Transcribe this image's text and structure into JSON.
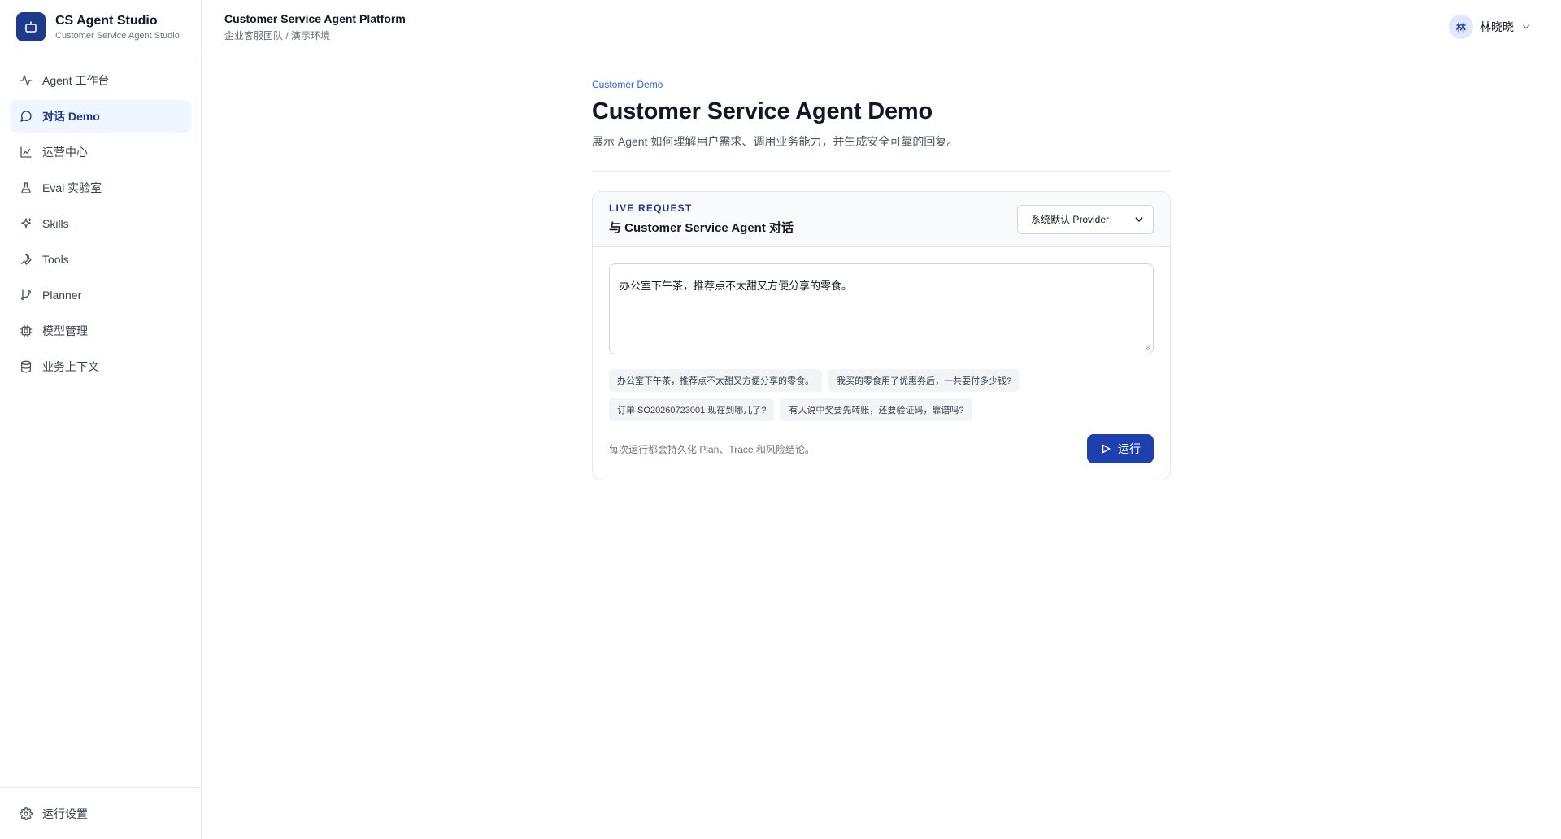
{
  "brand": {
    "title": "CS Agent Studio",
    "subtitle": "Customer Service Agent Studio"
  },
  "sidebar": {
    "items": [
      {
        "label": "Agent 工作台",
        "icon": "activity-icon",
        "active": false
      },
      {
        "label": "对话 Demo",
        "icon": "chat-icon",
        "active": true
      },
      {
        "label": "运营中心",
        "icon": "chart-icon",
        "active": false
      },
      {
        "label": "Eval 实验室",
        "icon": "flask-icon",
        "active": false
      },
      {
        "label": "Skills",
        "icon": "sparkles-icon",
        "active": false
      },
      {
        "label": "Tools",
        "icon": "wrench-icon",
        "active": false
      },
      {
        "label": "Planner",
        "icon": "branch-icon",
        "active": false
      },
      {
        "label": "模型管理",
        "icon": "cpu-icon",
        "active": false
      },
      {
        "label": "业务上下文",
        "icon": "database-icon",
        "active": false
      }
    ],
    "bottom": {
      "label": "运行设置",
      "icon": "gear-icon"
    }
  },
  "topbar": {
    "title": "Customer Service Agent Platform",
    "subtitle": "企业客服团队 / 演示环境",
    "user": {
      "avatar": "林",
      "name": "林晓晓"
    }
  },
  "page": {
    "eyebrow": "Customer Demo",
    "title": "Customer Service Agent Demo",
    "description": "展示 Agent 如何理解用户需求、调用业务能力，并生成安全可靠的回复。"
  },
  "card": {
    "kicker": "LIVE REQUEST",
    "title": "与 Customer Service Agent 对话",
    "provider": "系统默认 Provider",
    "input_value": "办公室下午茶，推荐点不太甜又方便分享的零食。",
    "suggestions": [
      "办公室下午茶，推荐点不太甜又方便分享的零食。",
      "我买的零食用了优惠券后，一共要付多少钱?",
      "订单 SO20260723001 现在到哪儿了?",
      "有人说中奖要先转账，还要验证码，靠谱吗?"
    ],
    "footnote": "每次运行都会持久化 Plan、Trace 和风险结论。",
    "run_label": "运行"
  },
  "colors": {
    "accent": "#1e3a8a",
    "primary_button": "#1e40af",
    "link": "#2563eb"
  }
}
